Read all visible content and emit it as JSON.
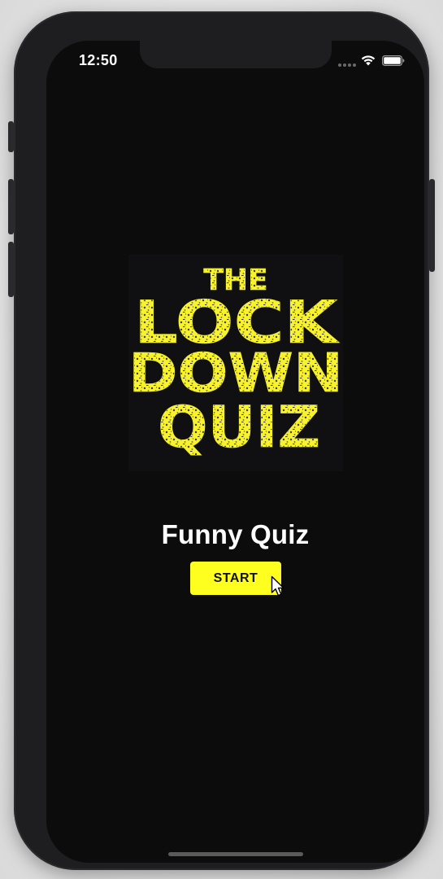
{
  "status_bar": {
    "time": "12:50",
    "signal_icon": "signal-dots-icon",
    "wifi_icon": "wifi-icon",
    "battery_icon": "battery-icon"
  },
  "logo": {
    "line1": "THE",
    "line2": "LOCK",
    "line3": "DOWN",
    "line4": "QUIZ",
    "color": "#f7f22c"
  },
  "main": {
    "title": "Funny Quiz",
    "start_label": "START",
    "start_color": "#ffff1f"
  },
  "colors": {
    "screen_background": "#0c0c0c",
    "text": "#ffffff"
  }
}
